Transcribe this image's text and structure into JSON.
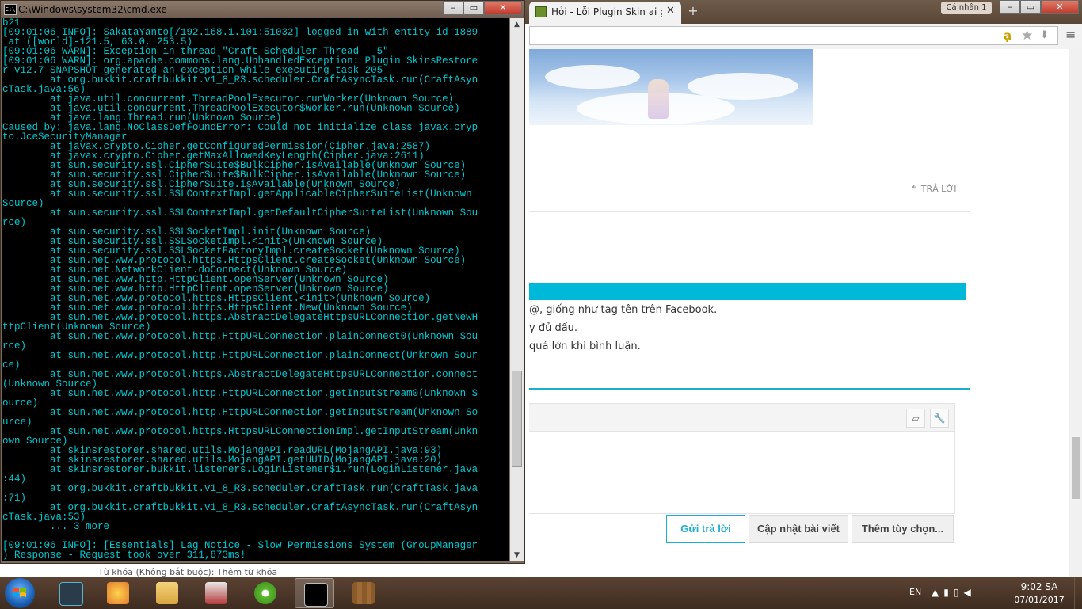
{
  "cmd": {
    "title": "C:\\Windows\\system32\\cmd.exe",
    "lines": [
      "b21",
      "[09:01:06 INFO]: SakataYanto[/192.168.1.101:51032] logged in with entity id 1889",
      " at ([world]-121.5, 63.0, 253.5)",
      "[09:01:06 WARN]: Exception in thread \"Craft Scheduler Thread - 5\"",
      "[09:01:06 WARN]: org.apache.commons.lang.UnhandledException: Plugin SkinsRestore",
      "r v12.7-SNAPSHOT generated an exception while executing task 205",
      "        at org.bukkit.craftbukkit.v1_8_R3.scheduler.CraftAsyncTask.run(CraftAsyn",
      "cTask.java:56)",
      "        at java.util.concurrent.ThreadPoolExecutor.runWorker(Unknown Source)",
      "        at java.util.concurrent.ThreadPoolExecutor$Worker.run(Unknown Source)",
      "        at java.lang.Thread.run(Unknown Source)",
      "Caused by: java.lang.NoClassDefFoundError: Could not initialize class javax.cryp",
      "to.JceSecurityManager",
      "        at javax.crypto.Cipher.getConfiguredPermission(Cipher.java:2587)",
      "        at javax.crypto.Cipher.getMaxAllowedKeyLength(Cipher.java:2611)",
      "        at sun.security.ssl.CipherSuite$BulkCipher.isAvailable(Unknown Source)",
      "        at sun.security.ssl.CipherSuite$BulkCipher.isAvailable(Unknown Source)",
      "        at sun.security.ssl.CipherSuite.isAvailable(Unknown Source)",
      "        at sun.security.ssl.SSLContextImpl.getApplicableCipherSuiteList(Unknown",
      "Source)",
      "        at sun.security.ssl.SSLContextImpl.getDefaultCipherSuiteList(Unknown Sou",
      "rce)",
      "        at sun.security.ssl.SSLSocketImpl.init(Unknown Source)",
      "        at sun.security.ssl.SSLSocketImpl.<init>(Unknown Source)",
      "        at sun.security.ssl.SSLSocketFactoryImpl.createSocket(Unknown Source)",
      "        at sun.net.www.protocol.https.HttpsClient.createSocket(Unknown Source)",
      "        at sun.net.NetworkClient.doConnect(Unknown Source)",
      "        at sun.net.www.http.HttpClient.openServer(Unknown Source)",
      "        at sun.net.www.http.HttpClient.openServer(Unknown Source)",
      "        at sun.net.www.protocol.https.HttpsClient.<init>(Unknown Source)",
      "        at sun.net.www.protocol.https.HttpsClient.New(Unknown Source)",
      "        at sun.net.www.protocol.https.AbstractDelegateHttpsURLConnection.getNewH",
      "ttpClient(Unknown Source)",
      "        at sun.net.www.protocol.http.HttpURLConnection.plainConnect0(Unknown Sou",
      "rce)",
      "        at sun.net.www.protocol.http.HttpURLConnection.plainConnect(Unknown Sour",
      "ce)",
      "        at sun.net.www.protocol.https.AbstractDelegateHttpsURLConnection.connect",
      "(Unknown Source)",
      "        at sun.net.www.protocol.http.HttpURLConnection.getInputStream0(Unknown S",
      "ource)",
      "        at sun.net.www.protocol.http.HttpURLConnection.getInputStream(Unknown So",
      "urce)",
      "        at sun.net.www.protocol.https.HttpsURLConnectionImpl.getInputStream(Unkn",
      "own Source)",
      "        at skinsrestorer.shared.utils.MojangAPI.readURL(MojangAPI.java:93)",
      "        at skinsrestorer.shared.utils.MojangAPI.getUUID(MojangAPI.java:20)",
      "        at skinsrestorer.bukkit.listeners.LoginListener$1.run(LoginListener.java",
      ":44)",
      "        at org.bukkit.craftbukkit.v1_8_R3.scheduler.CraftTask.run(CraftTask.java",
      ":71)",
      "        at org.bukkit.craftbukkit.v1_8_R3.scheduler.CraftAsyncTask.run(CraftAsyn",
      "cTask.java:53)",
      "        ... 3 more",
      "",
      "[09:01:06 INFO]: [Essentials] Lag Notice - Slow Permissions System (GroupManager",
      ") Response - Request took over 311,873ms!"
    ]
  },
  "browser": {
    "tab_title": "Hỏi - Lỗi Plugin Skin ai giú",
    "profile_label": "Cá nhân 1",
    "reply_link": "TRẢ LỜI",
    "hints": [
      "@, giống như tag tên trên Facebook.",
      "y đủ dấu.",
      "quá lớn khi bình luận."
    ],
    "buttons": {
      "send": "Gửi trả lời",
      "update": "Cập nhật bài viết",
      "more": "Thêm tùy chọn..."
    },
    "tag_label": "Từ khóa (Không bắt buộc): Thêm từ khóa"
  },
  "taskbar": {
    "lang": "EN",
    "time": "9:02 SA",
    "date": "07/01/2017"
  },
  "colors": {
    "console_text": "#00c8d0",
    "accent": "#00b8d8"
  }
}
